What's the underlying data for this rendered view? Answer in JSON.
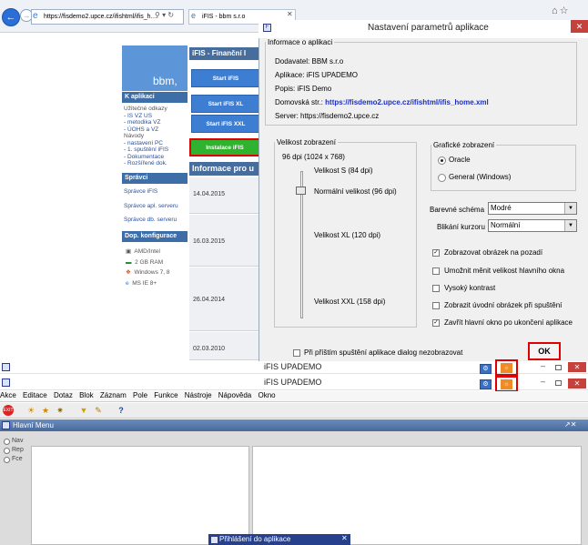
{
  "browser": {
    "url": "https://fisdemo2.upce.cz/ifishtml/ifis_h…",
    "tab_title": "iFIS - bbm s.r.o"
  },
  "website": {
    "logo": "bbm,",
    "banner": "iFIS - Finanční I",
    "sections": {
      "aplikaci_title": "K aplikaci",
      "aplikaci_items": [
        "Užitečné odkazy",
        "- IS VZ US",
        "- metodika VZ",
        "- ÚOHS a VZ",
        "Návody",
        "- nastavení PC",
        "- 1. spuštění iFIS",
        "- Dokumentace",
        "- Rozšířené dok."
      ],
      "spravci_title": "Správci",
      "spravci_items": [
        "Správce iFIS",
        "Správce apl. serveru",
        "Správce db. serveru"
      ],
      "konfigurace_title": "Dop. konfigurace",
      "konfigurace_items": [
        "AMD/Intel",
        "2 GB RAM",
        "Windows 7, 8",
        "MS IE 8+"
      ]
    },
    "buttons": [
      "Start iFIS",
      "Start iFIS XL",
      "Start iFIS XXL"
    ],
    "install_button": "Instalace iFIS",
    "news_title": "Informace pro u",
    "news_dates": [
      "14.04.2015",
      "16.03.2015",
      "26.04.2014",
      "02.03.2010"
    ]
  },
  "dialog": {
    "title": "Nastavení parametrů aplikace",
    "info_legend": "Informace o aplikaci",
    "info": {
      "dodavatel_label": "Dodavatel:",
      "dodavatel": "BBM s.r.o",
      "aplikace_label": "Aplikace:",
      "aplikace": "iFIS  UPADEMO",
      "popis_label": "Popis:",
      "popis": "iFIS Demo",
      "domovska_label": "Domovská str.:",
      "domovska": "https://fisdemo2.upce.cz/ifishtml/ifis_home.xml",
      "server_label": "Server:",
      "server": "https://fisdemo2.upce.cz"
    },
    "size_legend": "Velikost zobrazení",
    "size_current": "96 dpi (1024 x 768)",
    "size_options": [
      "Velikost S (84 dpi)",
      "Normální velikost (96 dpi)",
      "Velikost XL (120 dpi)",
      "Velikost XXL (158 dpi)"
    ],
    "graphics_legend": "Grafické zobrazení",
    "graphics_options": [
      "Oracle",
      "General (Windows)"
    ],
    "graphics_selected": "Oracle",
    "scheme_label": "Barevné schéma",
    "scheme_value": "Modré",
    "cursor_label": "Blikání kurzoru",
    "cursor_value": "Normální",
    "checkboxes": [
      {
        "label": "Zobrazovat obrázek na pozadí",
        "checked": true
      },
      {
        "label": "Umožnit měnit velikost hlavního okna",
        "checked": false
      },
      {
        "label": "Vysoký kontrast",
        "checked": false
      },
      {
        "label": "Zobrazit úvodní obrázek při spuštění",
        "checked": false
      },
      {
        "label": "Zavřít hlavní okno po ukončení aplikace",
        "checked": true
      }
    ],
    "dont_show_label": "Při příštím spuštění aplikace dialog nezobrazovat",
    "ok_label": "OK"
  },
  "taskbar": {
    "title1": "iFIS  UPADEMO",
    "title2": "iFIS  UPADEMO"
  },
  "app": {
    "menu": [
      "Akce",
      "Editace",
      "Dotaz",
      "Blok",
      "Záznam",
      "Pole",
      "Funkce",
      "Nástroje",
      "Nápověda",
      "Okno"
    ],
    "main_title": "Hlavní Menu",
    "radios": [
      "Nav",
      "Rep",
      "Fce"
    ],
    "login_title": "Přihlášení do aplikace"
  },
  "colors": {
    "highlight": "#e00000",
    "install_green": "#2fb32f",
    "accent_blue": "#3e7ed2"
  }
}
